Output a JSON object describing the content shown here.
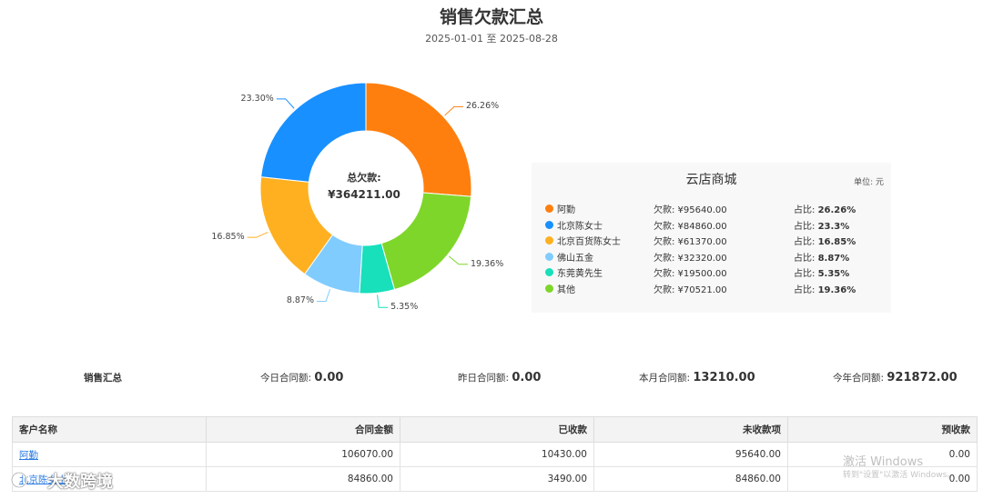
{
  "header": {
    "title": "销售欠款汇总",
    "date_range": "2025-01-01 至 2025-08-28"
  },
  "center": {
    "label": "总欠款:",
    "value": "¥364211.00"
  },
  "chart_data": {
    "type": "pie",
    "donut": true,
    "categories": [
      "阿勤",
      "北京陈女士",
      "北京百货陈女士",
      "佛山五金",
      "东莞黄先生",
      "其他"
    ],
    "values": [
      26.26,
      23.3,
      16.85,
      8.87,
      5.35,
      19.36
    ],
    "labels": [
      "26.26%",
      "23.30%",
      "16.85%",
      "8.87%",
      "5.35%",
      "19.36%"
    ],
    "slice_order_clockwise_from_top": [
      "阿勤",
      "其他",
      "东莞黄先生",
      "佛山五金",
      "北京百货陈女士",
      "北京陈女士"
    ],
    "colors": [
      "#ff7f0e",
      "#1890ff",
      "#ffb020",
      "#80ccff",
      "#17e0bb",
      "#7ed62a"
    ]
  },
  "legend": {
    "title": "云店商城",
    "unit": "单位: 元",
    "items": [
      {
        "name": "阿勤",
        "debt": "欠款: ¥95640.00",
        "pct_label": "占比:",
        "pct": "26.26%",
        "color": "#ff7f0e"
      },
      {
        "name": "北京陈女士",
        "debt": "欠款: ¥84860.00",
        "pct_label": "占比:",
        "pct": "23.3%",
        "color": "#1890ff"
      },
      {
        "name": "北京百货陈女士",
        "debt": "欠款: ¥61370.00",
        "pct_label": "占比:",
        "pct": "16.85%",
        "color": "#ffb020"
      },
      {
        "name": "佛山五金",
        "debt": "欠款: ¥32320.00",
        "pct_label": "占比:",
        "pct": "8.87%",
        "color": "#80ccff"
      },
      {
        "name": "东莞黄先生",
        "debt": "欠款: ¥19500.00",
        "pct_label": "占比:",
        "pct": "5.35%",
        "color": "#17e0bb"
      },
      {
        "name": "其他",
        "debt": "欠款: ¥70521.00",
        "pct_label": "占比:",
        "pct": "19.36%",
        "color": "#7ed62a"
      }
    ]
  },
  "summary": {
    "title": "销售汇总",
    "today_label": "今日合同额:",
    "today_value": "0.00",
    "yesterday_label": "昨日合同额:",
    "yesterday_value": "0.00",
    "month_label": "本月合同额:",
    "month_value": "13210.00",
    "year_label": "今年合同额:",
    "year_value": "921872.00"
  },
  "table": {
    "headers": [
      "客户名称",
      "合同金额",
      "已收款",
      "未收款项",
      "预收款"
    ],
    "rows": [
      [
        "阿勤",
        "106070.00",
        "10430.00",
        "95640.00",
        "0.00"
      ],
      [
        "北京陈女士",
        "84860.00",
        "3490.00",
        "84860.00",
        "0.00"
      ]
    ]
  },
  "watermark": {
    "activate_line1": "激活 Windows",
    "activate_line2": "转到\"设置\"以激活 Windows。",
    "logo_text": "大数跨境"
  }
}
